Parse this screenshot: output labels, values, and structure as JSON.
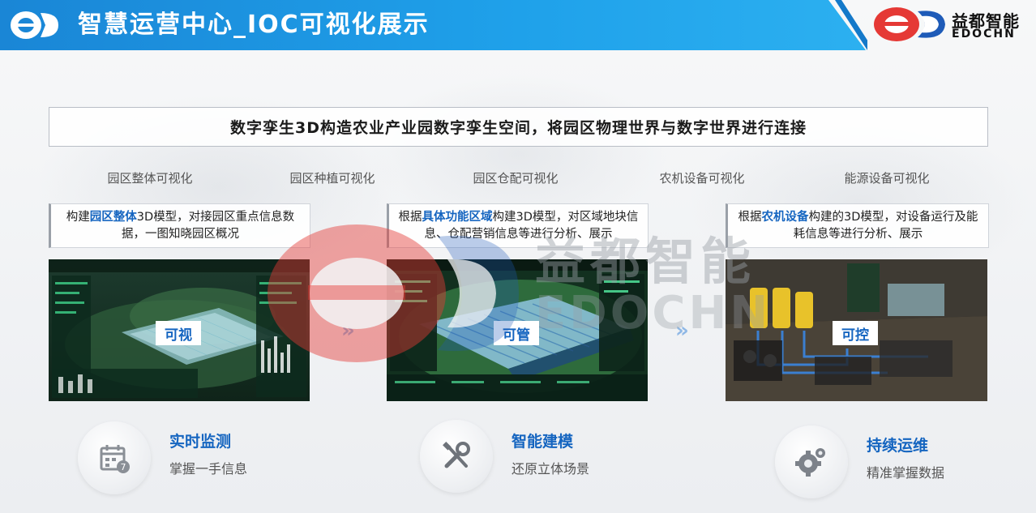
{
  "header": {
    "title": "智慧运营中心_IOC可视化展示",
    "brand_cn": "益都智能",
    "brand_en": "EDOCHN"
  },
  "banner": {
    "text": "数字孪生3D构造农业产业园数字孪生空间，将园区物理世界与数字世界进行连接"
  },
  "categories": [
    "园区整体可视化",
    "园区种植可视化",
    "园区仓配可视化",
    "农机设备可视化",
    "能源设备可视化"
  ],
  "descriptions": [
    {
      "pre": "构建",
      "highlight": "园区整体",
      "post": "3D模型，对接园区重点信息数据，一图知晓园区概况"
    },
    {
      "pre": "根据",
      "highlight": "具体功能区域",
      "post": "构建3D模型，对区域地块信息、仓配营销信息等进行分析、展示"
    },
    {
      "pre": "根据",
      "highlight": "农机设备",
      "post": "构建的3D模型，对设备运行及能耗信息等进行分析、展示"
    }
  ],
  "screens": [
    {
      "tag": "可视"
    },
    {
      "tag": "可管"
    },
    {
      "tag": "可控"
    }
  ],
  "arrows": [
    "»",
    "»"
  ],
  "watermark": {
    "cn": "益都智能",
    "en": "EDOCHN"
  },
  "features": [
    {
      "title": "实时监测",
      "subtitle": "掌握一手信息",
      "icon": "calendar-icon"
    },
    {
      "title": "智能建模",
      "subtitle": "还原立体场景",
      "icon": "tools-icon"
    },
    {
      "title": "持续运维",
      "subtitle": "精准掌握数据",
      "icon": "gear-icon"
    }
  ],
  "colors": {
    "header_blue": "#1fa1ea",
    "accent_blue": "#1565c0",
    "brand_red": "#e53935"
  }
}
